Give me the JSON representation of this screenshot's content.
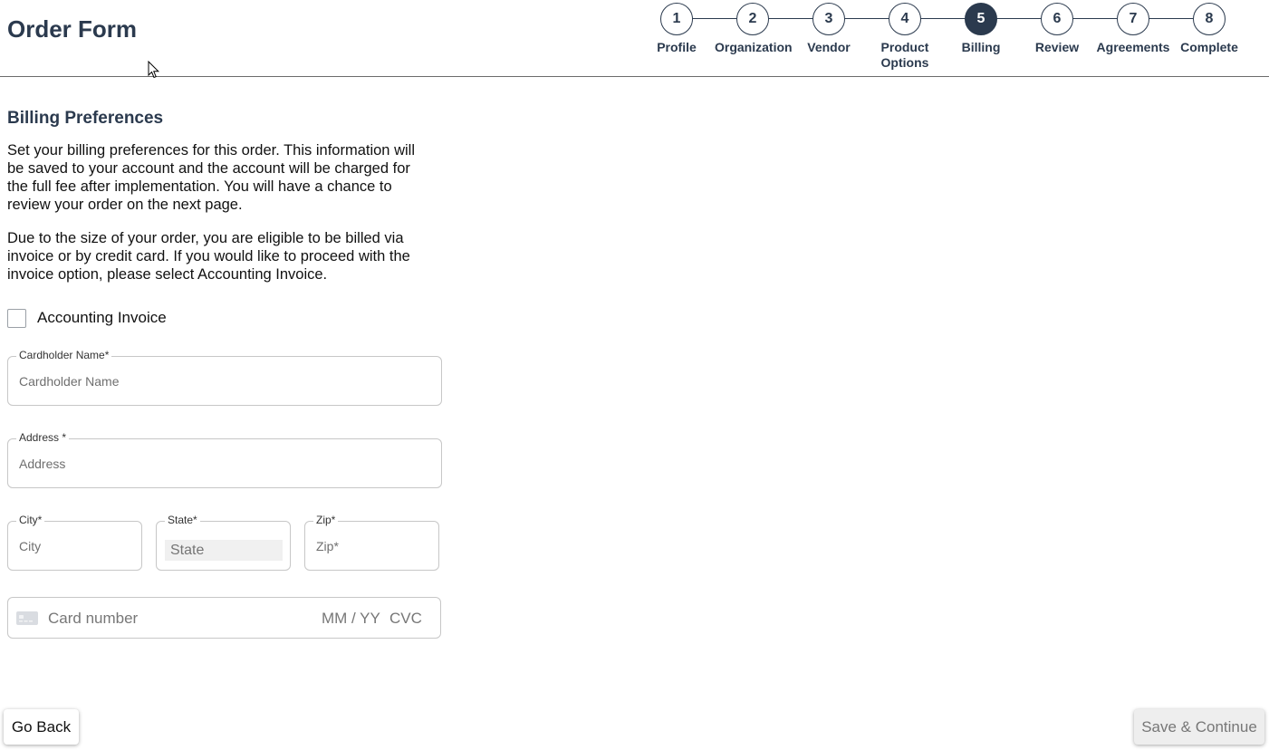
{
  "header": {
    "title": "Order Form"
  },
  "stepper": {
    "active_step": 5,
    "steps": [
      {
        "number": "1",
        "label": "Profile"
      },
      {
        "number": "2",
        "label": "Organization"
      },
      {
        "number": "3",
        "label": "Vendor"
      },
      {
        "number": "4",
        "label": "Product Options"
      },
      {
        "number": "5",
        "label": "Billing"
      },
      {
        "number": "6",
        "label": "Review"
      },
      {
        "number": "7",
        "label": "Agreements"
      },
      {
        "number": "8",
        "label": "Complete"
      }
    ]
  },
  "billing": {
    "title": "Billing Preferences",
    "paragraph_1": "Set your billing preferences for this order. This information will be saved to your account and the account will be charged for the full fee after implementation. You will have a chance to review your order on the next page.",
    "paragraph_2": "Due to the size of your order, you are eligible to be billed via invoice or by credit card. If you would like to proceed with the invoice option, please select Accounting Invoice.",
    "invoice_checkbox": {
      "label": "Accounting Invoice",
      "checked": false
    }
  },
  "form": {
    "cardholder_name": {
      "label": "Cardholder Name*",
      "placeholder": "Cardholder Name",
      "value": ""
    },
    "address": {
      "label": "Address *",
      "placeholder": "Address",
      "value": ""
    },
    "city": {
      "label": "City*",
      "placeholder": "City",
      "value": ""
    },
    "state": {
      "label": "State*",
      "selected": "State"
    },
    "zip": {
      "label": "Zip*",
      "placeholder": "Zip*",
      "value": ""
    }
  },
  "card": {
    "icon": "credit-card-icon",
    "number_placeholder": "Card number",
    "expiry_placeholder": "MM / YY",
    "cvc_placeholder": "CVC"
  },
  "actions": {
    "back_label": "Go Back",
    "save_label": "Save & Continue"
  },
  "colors": {
    "primary": "#2b3a4e"
  }
}
